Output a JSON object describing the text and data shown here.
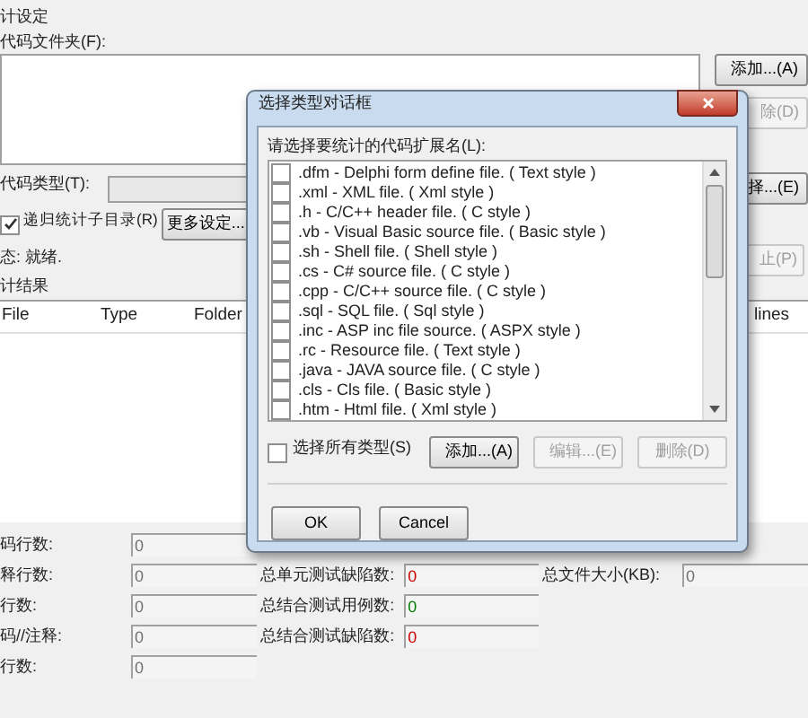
{
  "settings": {
    "group_title": "计设定",
    "folder_label": "代码文件夹(F):",
    "add_button": "添加...(A)",
    "remove_button": {
      "label": "除(D)",
      "disabled": true
    },
    "type_label": "代码类型(T):",
    "select_button": "择...(E)",
    "recursive": {
      "label": "递归统计子目录(R)",
      "checked": true
    },
    "more_button": "更多设定...",
    "status": "态:  就绪.",
    "stop_button": {
      "label": "止(P)",
      "disabled": true
    }
  },
  "results": {
    "title": "计结果",
    "columns": [
      "File",
      "Type",
      "Folder",
      "lines"
    ]
  },
  "stats": {
    "left": [
      {
        "label": "码行数:",
        "value": "0"
      },
      {
        "label": "释行数:",
        "value": "0"
      },
      {
        "label": "行数:",
        "value": "0"
      },
      {
        "label": "码//注释:",
        "value": "0"
      },
      {
        "label": "行数:",
        "value": "0"
      }
    ],
    "middle": [
      {
        "label": "总单元测试缺陷数:",
        "value": "0",
        "color": "#cc0000"
      },
      {
        "label": "总结合测试用例数:",
        "value": "0",
        "color": "#008000"
      },
      {
        "label": "总结合测试缺陷数:",
        "value": "0",
        "color": "#cc0000"
      }
    ],
    "right": [
      {
        "label": "总文件大小(KB):",
        "value": "0"
      }
    ]
  },
  "dialog": {
    "title": "选择类型对话框",
    "list_label": "请选择要统计的代码扩展名(L):",
    "items": [
      {
        "label": ".dfm - Delphi form define file. ( Text style )",
        "checked": false
      },
      {
        "label": ".xml - XML file. ( Xml style )",
        "checked": false
      },
      {
        "label": ".h - C/C++ header file. ( C style )",
        "checked": false
      },
      {
        "label": ".vb - Visual Basic source file. ( Basic style )",
        "checked": false
      },
      {
        "label": ".sh - Shell file. ( Shell style )",
        "checked": false
      },
      {
        "label": ".cs - C# source file. ( C style )",
        "checked": false
      },
      {
        "label": ".cpp - C/C++ source file. ( C style )",
        "checked": false
      },
      {
        "label": ".sql - SQL file. ( Sql style )",
        "checked": false
      },
      {
        "label": ".inc - ASP inc file source. ( ASPX style )",
        "checked": false
      },
      {
        "label": ".rc - Resource file. ( Text style )",
        "checked": false
      },
      {
        "label": ".java - JAVA source file. ( C style )",
        "checked": false
      },
      {
        "label": ".cls - Cls file. ( Basic style )",
        "checked": false
      },
      {
        "label": ".htm - Html file. ( Xml style )",
        "checked": false
      }
    ],
    "select_all": {
      "label": "选择所有类型(S)",
      "checked": false
    },
    "buttons": [
      {
        "label": "添加...(A)",
        "disabled": false
      },
      {
        "label": "编辑...(E)",
        "disabled": true
      },
      {
        "label": "删除(D)",
        "disabled": true
      }
    ],
    "ok": "OK",
    "cancel": "Cancel"
  }
}
